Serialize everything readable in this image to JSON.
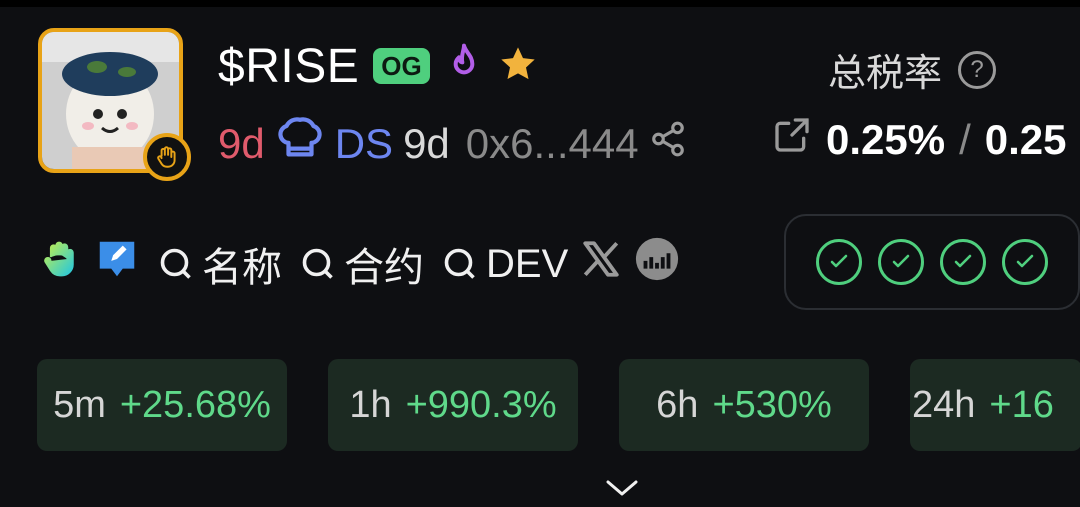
{
  "token": {
    "ticker": "$RISE",
    "og_badge": "OG",
    "age_primary": "9d",
    "ds_label": "DS",
    "age_secondary": "9d",
    "address": "0x6...444"
  },
  "tax": {
    "title": "总税率",
    "help": "?",
    "buy": "0.25%",
    "separator": "/",
    "sell": "0.25"
  },
  "links": {
    "name_search": "名称",
    "contract_search": "合约",
    "dev_search": "DEV"
  },
  "stats": [
    {
      "period": "5m",
      "change": "+25.68%"
    },
    {
      "period": "1h",
      "change": "+990.3%"
    },
    {
      "period": "6h",
      "change": "+530%"
    },
    {
      "period": "24h",
      "change": "+16"
    }
  ],
  "colors": {
    "accent_green": "#4fcf7e",
    "gold": "#e8a317",
    "age_red": "#e05b6c",
    "ds_blue": "#6d86f0"
  },
  "icons": {
    "fire": "fire-icon",
    "star": "star-icon",
    "chef": "chef-hat-icon",
    "share": "share-icon",
    "external": "external-link-icon",
    "wave": "wave-hand-icon",
    "edit": "edit-icon",
    "search": "search-icon",
    "x": "x-logo-icon",
    "chart": "chart-icon",
    "check": "check-circle-icon",
    "chevron": "chevron-down-icon"
  }
}
